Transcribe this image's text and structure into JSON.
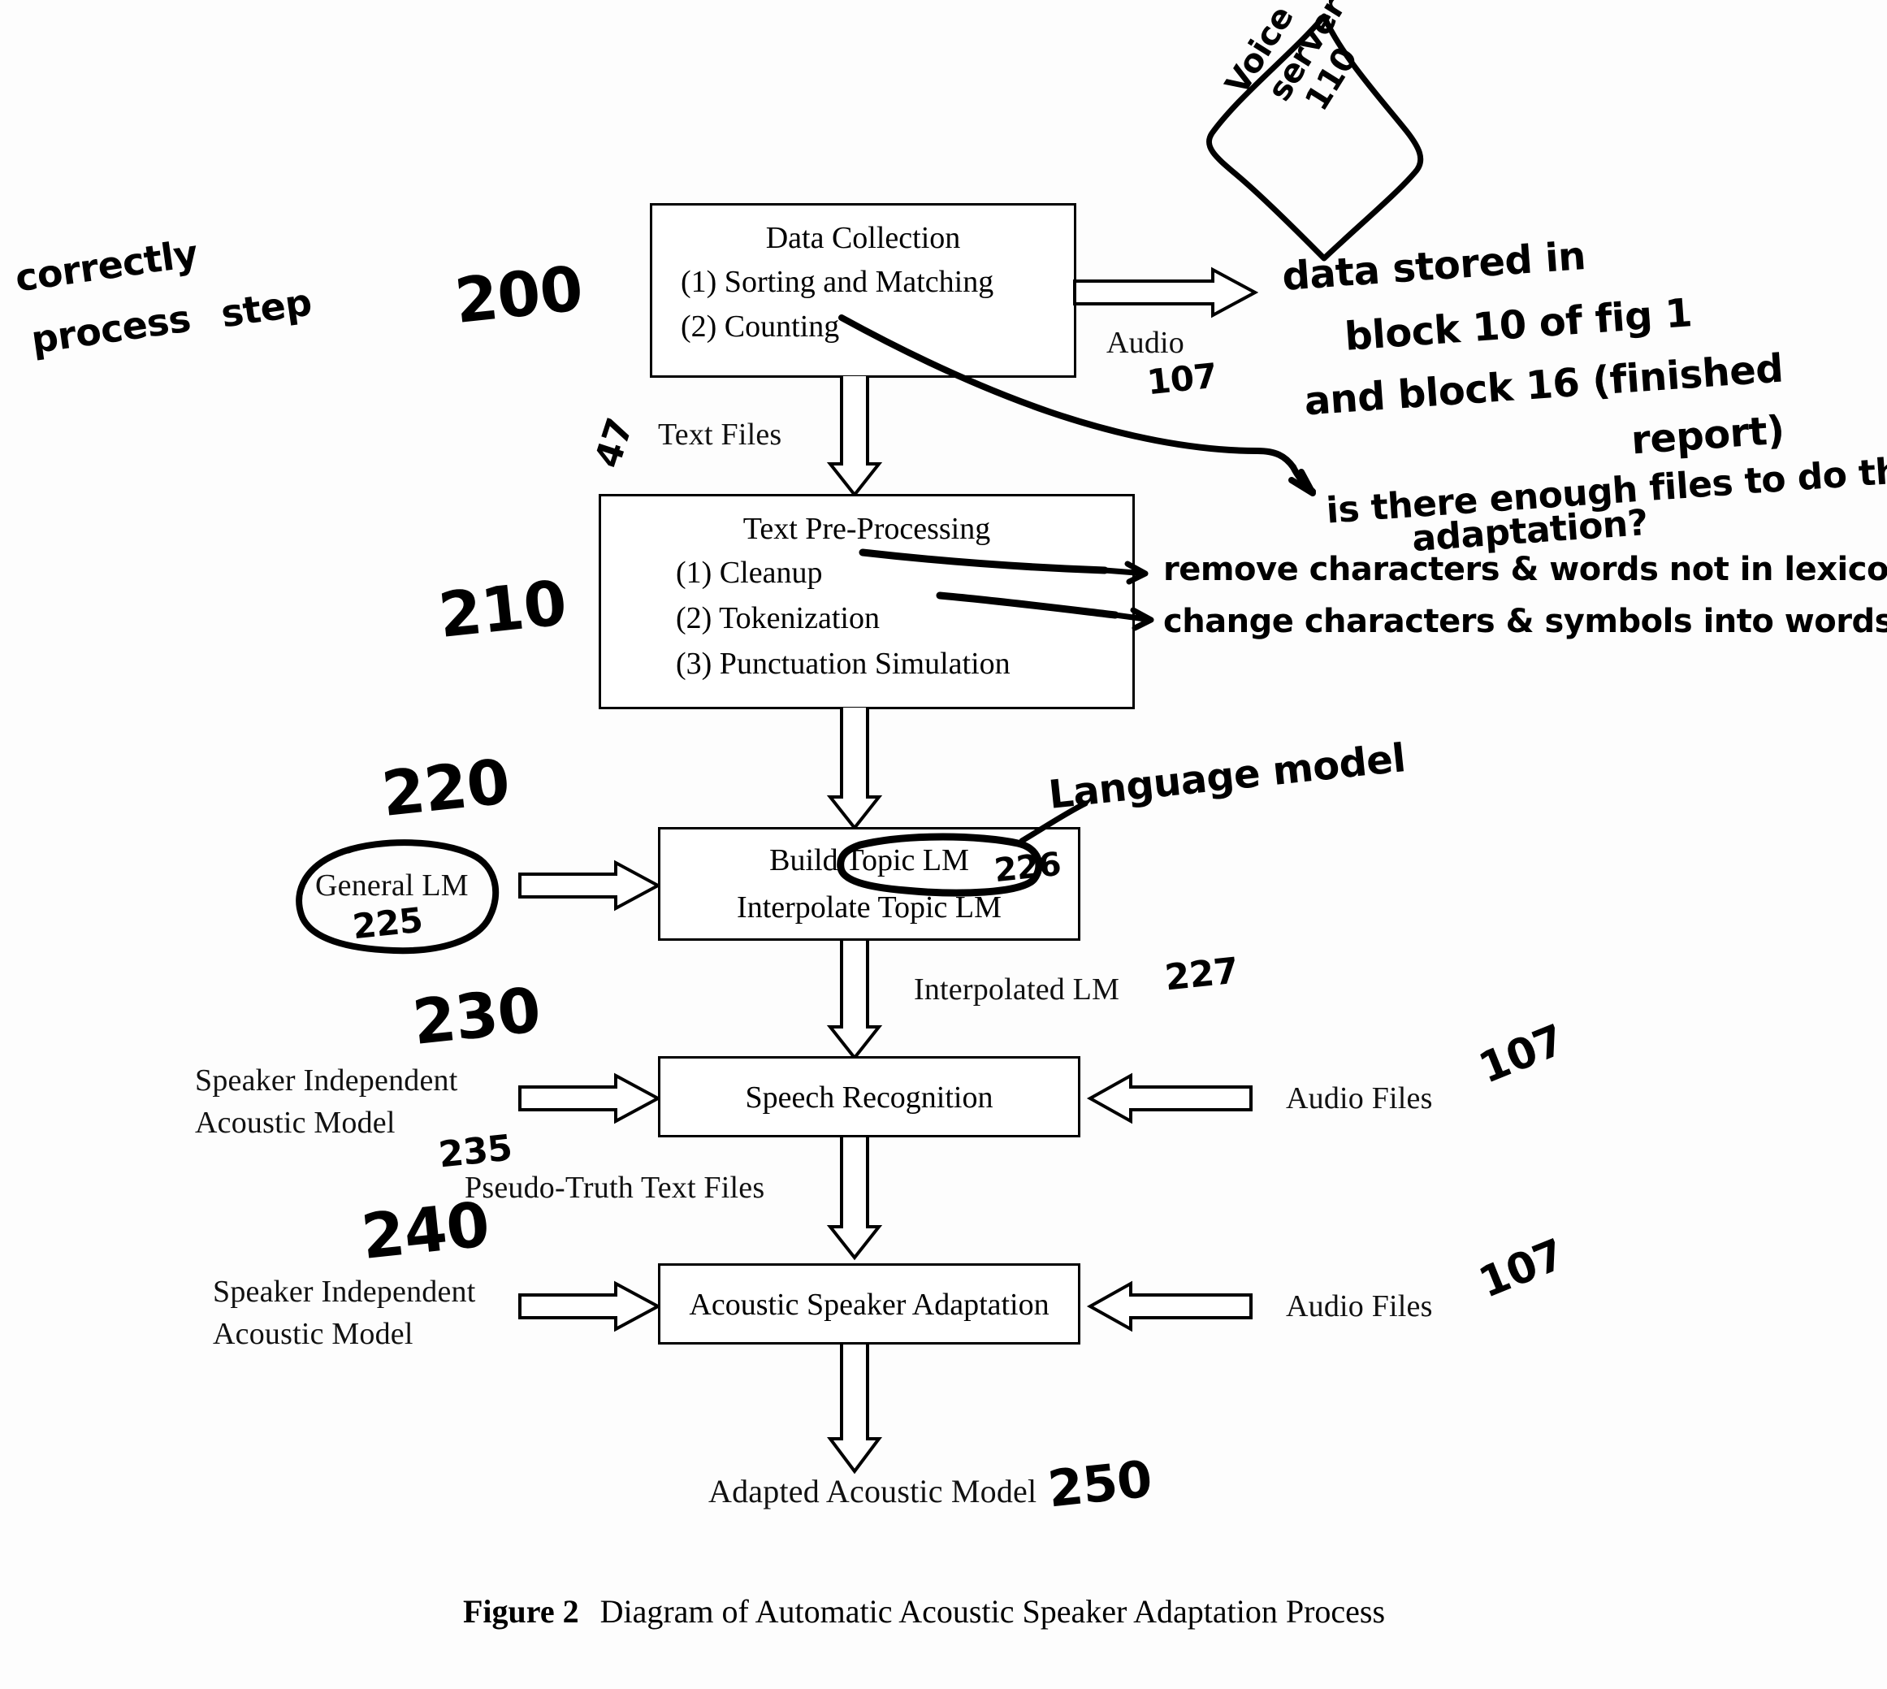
{
  "figure": {
    "caption_label": "Figure 2",
    "caption_text": "Diagram of Automatic Acoustic Speaker Adaptation Process"
  },
  "boxes": {
    "data_collection": {
      "title": "Data Collection",
      "items": [
        "(1) Sorting and Matching",
        "(2) Counting"
      ],
      "ref": "200"
    },
    "text_preprocessing": {
      "title": "Text Pre-Processing",
      "items": [
        "(1)   Cleanup",
        "(2)   Tokenization",
        "(3)   Punctuation Simulation"
      ],
      "ref": "210"
    },
    "build_topic_lm": {
      "line1": "Build Topic LM",
      "line2": "Interpolate Topic LM",
      "ref": "220",
      "circled_ref": "226"
    },
    "speech_recognition": {
      "title": "Speech Recognition",
      "ref": "230"
    },
    "acoustic_speaker_adaptation": {
      "title": "Acoustic Speaker Adaptation",
      "ref": "240"
    }
  },
  "inputs": {
    "general_lm": {
      "label": "General LM",
      "ref": "225"
    },
    "si_acoustic_model_1": {
      "line1": "Speaker Independent",
      "line2": "Acoustic Model"
    },
    "si_acoustic_model_2": {
      "line1": "Speaker Independent",
      "line2": "Acoustic Model"
    },
    "audio_files_1": {
      "label": "Audio Files",
      "ref": "107"
    },
    "audio_files_2": {
      "label": "Audio Files",
      "ref": "107"
    }
  },
  "flow_labels": {
    "text_files": {
      "label": "Text Files",
      "ref": "47"
    },
    "audio": {
      "label": "Audio",
      "ref": "107"
    },
    "interpolated_lm": {
      "label": "Interpolated LM",
      "ref": "227"
    },
    "pseudo_truth": {
      "label": "Pseudo-Truth Text Files",
      "ref": "235"
    },
    "adapted_acoustic_model": {
      "label": "Adapted Acoustic Model",
      "ref": "250"
    }
  },
  "annotations": {
    "left_note_line1": "correctly",
    "left_note_line2": "process",
    "left_note_line3": "step",
    "voice_server": {
      "line1": "Voice",
      "line2": "server",
      "line3": "110"
    },
    "data_stored": {
      "line1": "data stored in",
      "line2": "block 10 of fig 1",
      "line3": "and block 16 (finished",
      "line4": "report)"
    },
    "enough_files": {
      "line1": "is there enough files to do the",
      "line2": "adaptation?"
    },
    "cleanup_note": "remove characters & words not in lexicon",
    "tokenization_note": "change characters & symbols into words",
    "language_model_note": "Language model"
  }
}
